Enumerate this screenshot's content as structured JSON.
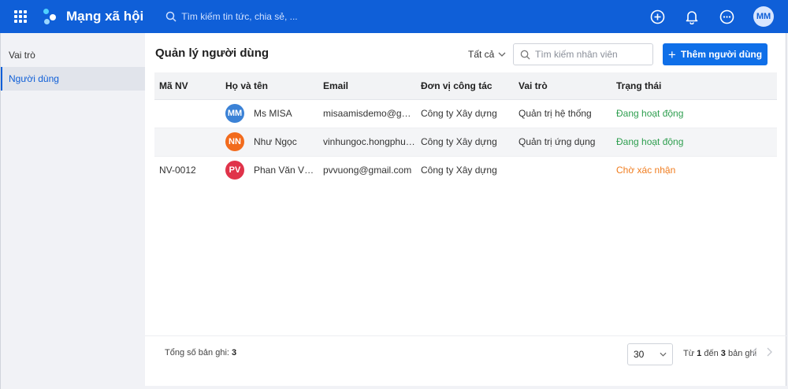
{
  "header": {
    "brand": "Mạng xã hội",
    "search_placeholder": "Tìm kiếm tin tức, chia sẻ, ...",
    "avatar_initials": "MM"
  },
  "sidebar": {
    "items": [
      {
        "label": "Vai trò",
        "active": false
      },
      {
        "label": "Người dùng",
        "active": true
      }
    ]
  },
  "main": {
    "title": "Quản lý người dùng",
    "filter_label": "Tất cả",
    "search_placeholder": "Tìm kiếm nhân viên",
    "add_button": "Thêm người dùng"
  },
  "table": {
    "columns": [
      "Mã NV",
      "Họ và tên",
      "Email",
      "Đơn vị công tác",
      "Vai trò",
      "Trạng thái"
    ],
    "rows": [
      {
        "code": "",
        "initials": "MM",
        "avatar_color": "#3b82d6",
        "name": "Ms MISA",
        "email": "misaamisdemo@gmail.com",
        "unit": "Công ty Xây dựng",
        "role": "Quản trị hệ thống",
        "status": "Đang hoạt động",
        "status_color": "#2e9e4f"
      },
      {
        "code": "",
        "initials": "NN",
        "avatar_color": "#f26b1d",
        "name": "Như Ngọc",
        "email": "vinhungoc.hongphuc@gmail.com",
        "unit": "Công ty Xây dựng",
        "role": "Quản trị ứng dụng",
        "status": "Đang hoạt động",
        "status_color": "#2e9e4f"
      },
      {
        "code": "NV-0012",
        "initials": "PV",
        "avatar_color": "#e0334a",
        "name": "Phan Văn Vượng",
        "email": "pvvuong@gmail.com",
        "unit": "Công ty Xây dựng",
        "role": "",
        "status": "Chờ xác nhận",
        "status_color": "#f07c1e"
      }
    ]
  },
  "footer": {
    "total_label": "Tổng số bản ghi:",
    "total_value": "3",
    "page_size": "30",
    "range_from_label": "Từ",
    "range_from": "1",
    "range_to_label": "đến",
    "range_to": "3",
    "range_suffix": "bản ghi"
  },
  "colors": {
    "header_bg": "#0f5fd8",
    "primary_button": "#0f6fe8",
    "active_status": "#2e9e4f",
    "pending_status": "#f07c1e"
  }
}
